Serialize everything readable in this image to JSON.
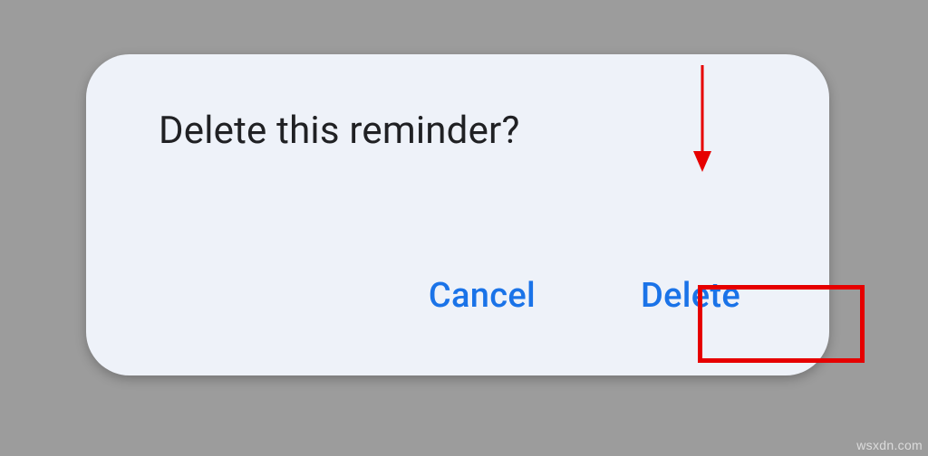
{
  "dialog": {
    "title": "Delete this reminder?",
    "actions": {
      "cancel_label": "Cancel",
      "confirm_label": "Delete"
    }
  },
  "annotations": {
    "highlight_color": "#e60000",
    "arrow_color": "#e60000"
  },
  "watermark": "wsxdn.com"
}
